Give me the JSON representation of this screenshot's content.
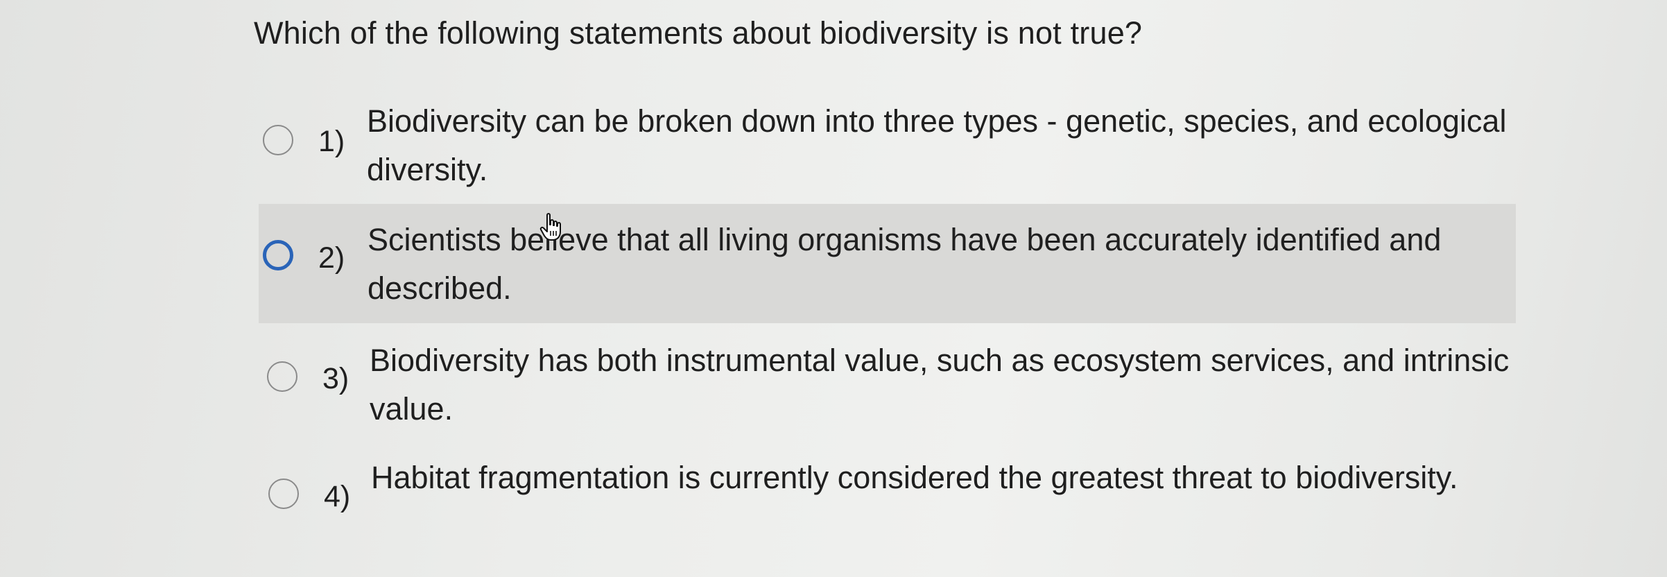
{
  "question": {
    "text": "Which of the following statements about biodiversity is not true?"
  },
  "options": [
    {
      "number": "1)",
      "text": "Biodiversity can be broken down into three types - genetic, species, and ecological diversity.",
      "focused": false,
      "hovered": false
    },
    {
      "number": "2)",
      "text": "Scientists believe that all living organisms have been accurately identified and described.",
      "focused": true,
      "hovered": true
    },
    {
      "number": "3)",
      "text": "Biodiversity has both instrumental value, such as ecosystem services, and intrinsic value.",
      "focused": false,
      "hovered": false
    },
    {
      "number": "4)",
      "text": "Habitat fragmentation is currently considered the greatest threat to biodiversity.",
      "focused": false,
      "hovered": false
    }
  ],
  "colors": {
    "focus_ring": "#2a64b8",
    "hover_background": "#d9d9d7",
    "radio_border": "#8a8a8a",
    "text": "#1f1f1f"
  },
  "cursor": {
    "icon": "hand-pointer-icon"
  }
}
